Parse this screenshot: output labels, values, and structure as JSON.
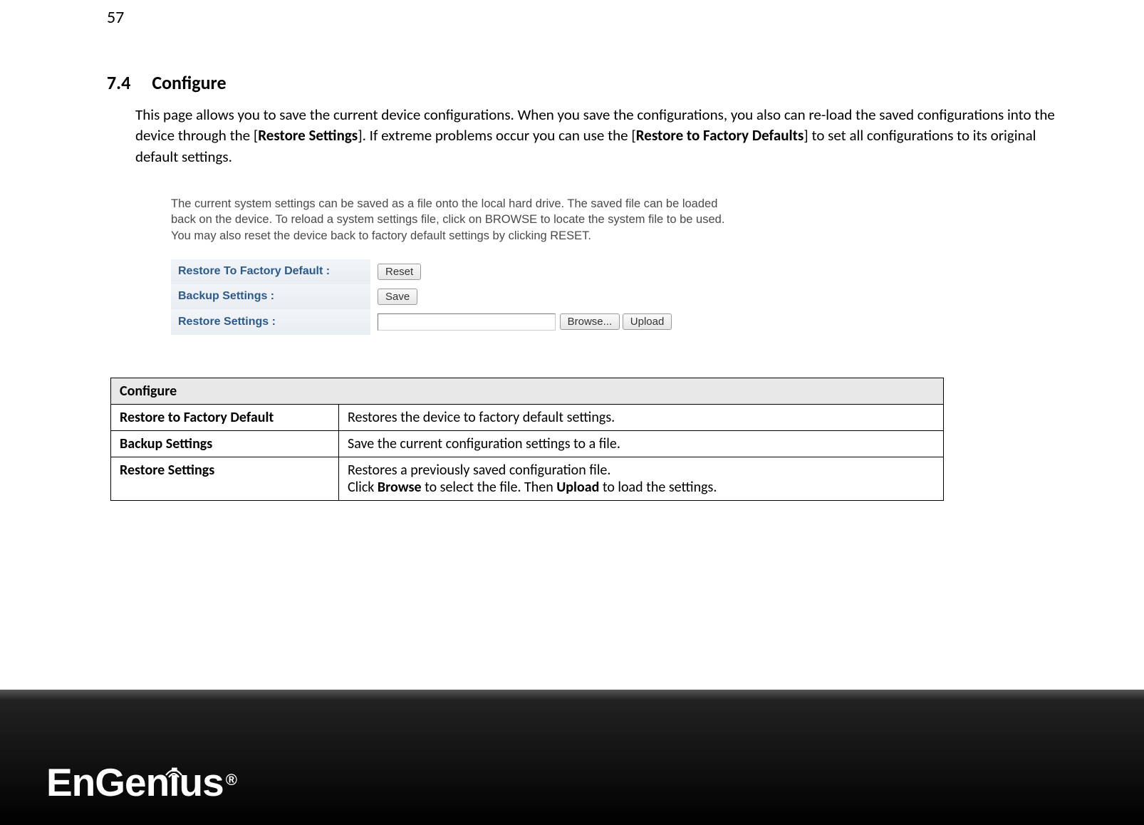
{
  "page_number": "57",
  "section": {
    "number": "7.4",
    "title": "Configure"
  },
  "intro": {
    "part1": "This page allows you to save the current device configurations. When you save the configurations, you also can re-load the saved configurations into the device through the [",
    "bold1": "Restore Settings",
    "part2": "]. If extreme problems occur you can use the [",
    "bold2": "Restore to Factory Defaults",
    "part3": "] to set all configurations to its original default settings."
  },
  "screenshot": {
    "description": "The current system settings can be saved as a file onto the local hard drive. The saved file can be loaded back on the device. To reload a system settings file, click on BROWSE to locate the system file to be used. You may also reset the device back to factory default settings by clicking RESET.",
    "rows": {
      "factory_label": "Restore To Factory Default :",
      "factory_button": "Reset",
      "backup_label": "Backup Settings :",
      "backup_button": "Save",
      "restore_label": "Restore Settings :",
      "browse_button": "Browse...",
      "upload_button": "Upload"
    }
  },
  "config_table": {
    "header": "Configure",
    "rows": [
      {
        "label": "Restore to Factory Default",
        "desc_plain": "Restores the device to factory default settings."
      },
      {
        "label": "Backup Settings",
        "desc_plain": "Save the current configuration settings to a file."
      },
      {
        "label": "Restore Settings",
        "desc_line1": "Restores a previously saved configuration file.",
        "desc_p1": "Click ",
        "desc_b1": "Browse",
        "desc_p2": " to select the file. Then ",
        "desc_b2": "Upload",
        "desc_p3": " to load the settings."
      }
    ]
  },
  "logo": {
    "text_pre": "EnGen",
    "text_i": "i",
    "text_post": "us",
    "reg": "®"
  }
}
